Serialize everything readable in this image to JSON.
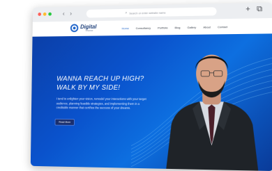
{
  "browser": {
    "dots": [
      "#ff5f57",
      "#febc2e",
      "#28c840"
    ],
    "back_icon": "chevron-left-icon",
    "forward_icon": "chevron-right-icon",
    "url_placeholder": "Search or enter website name",
    "new_tab_icon": "plus-icon",
    "tabs_icon": "tabs-icon"
  },
  "site": {
    "logo": {
      "main": "Digital",
      "sub": "Channel"
    },
    "menu": [
      "Home",
      "Consultancy",
      "Portfolio",
      "Blog",
      "Gallery",
      "About",
      "Contact"
    ],
    "active_menu": "Home",
    "accent": "#1d63c9"
  },
  "hero": {
    "headline_line1": "WANNA REACH UP HIGH?",
    "headline_line2": "WALK BY MY SIDE!",
    "description": "I tend to enlighten your vision, remodel your interactions with your target audience, planning feasible strategies, and implementing them in a creditable manner that certifies the success of your dreams.",
    "cta_label": "Read More",
    "background": "#0a52cc"
  }
}
